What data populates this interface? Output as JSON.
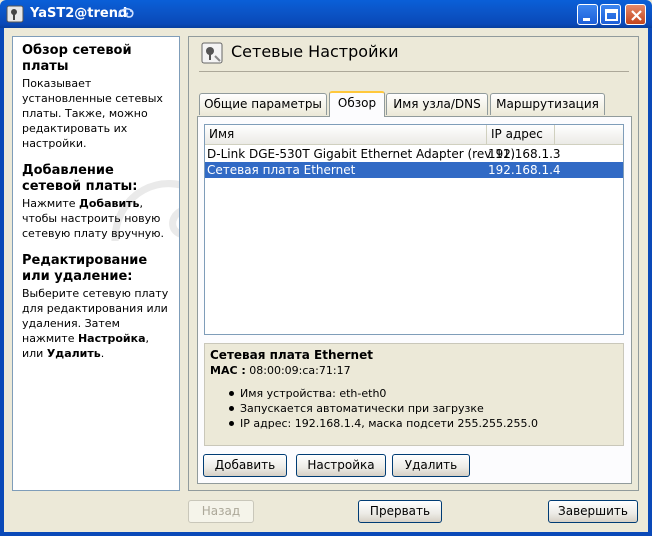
{
  "window": {
    "title": "YaST2@trend"
  },
  "help": {
    "sections": [
      {
        "heading": "Обзор сетевой платы",
        "text": "Показывает установленные сетевых платы. Также, можно редактировать их настройки."
      },
      {
        "heading": "Добавление сетевой платы:",
        "text_before": "Нажмите ",
        "bold": "Добавить",
        "text_after": ", чтобы настроить новую сетевую плату вручную."
      },
      {
        "heading": "Редактирование или удаление:",
        "text_before": "Выберите сетевую плату для редактирования или удаления. Затем нажмите ",
        "bold": "Настройка",
        "text_mid": ", или ",
        "bold2": "Удалить",
        "text_after": "."
      }
    ]
  },
  "main": {
    "title": "Сетевые Настройки"
  },
  "tabs": [
    {
      "label": "Общие параметры",
      "active": false
    },
    {
      "label": "Обзор",
      "active": true
    },
    {
      "label": "Имя узла/DNS",
      "active": false
    },
    {
      "label": "Маршрутизация",
      "active": false
    }
  ],
  "table": {
    "columns": [
      "Имя",
      "IP адрес"
    ],
    "rows": [
      {
        "name": "D-Link DGE-530T Gigabit Ethernet Adapter (rev 11)",
        "ip": "192.168.1.3",
        "selected": false
      },
      {
        "name": "Сетевая плата Ethernet",
        "ip": "192.168.1.4",
        "selected": true
      }
    ]
  },
  "details": {
    "title": "Сетевая плата Ethernet",
    "mac_label": "MAC :",
    "mac_value": " 08:00:09:ca:71:17",
    "items": [
      "Имя устройства: eth-eth0",
      "Запускается автоматически при загрузке",
      "IP адрес: 192.168.1.4, маска подсети 255.255.255.0"
    ]
  },
  "buttons": {
    "add": "Добавить",
    "configure": "Настройка",
    "delete": "Удалить",
    "back": "Назад",
    "abort": "Прервать",
    "finish": "Завершить"
  },
  "colors": {
    "titlebar": "#0a49b8",
    "selection": "#316ac5",
    "tab_highlight": "#ffc83c"
  }
}
